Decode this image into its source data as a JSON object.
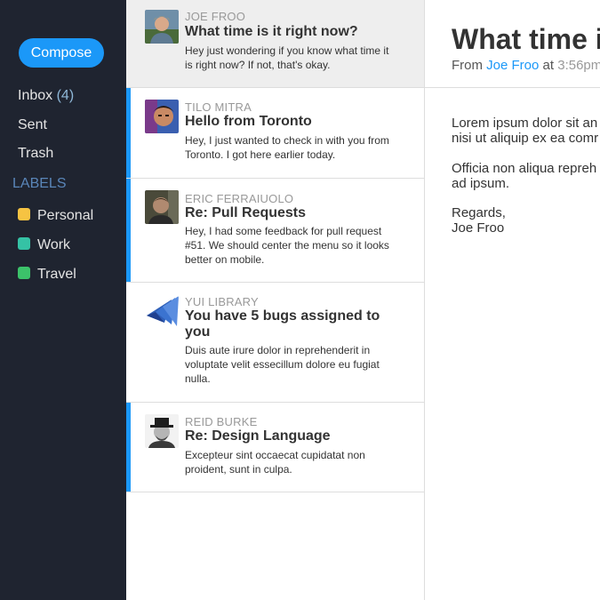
{
  "sidebar": {
    "compose_label": "Compose",
    "nav": [
      {
        "label": "Inbox",
        "count": "(4)"
      },
      {
        "label": "Sent"
      },
      {
        "label": "Trash"
      }
    ],
    "labels_heading": "LABELS",
    "labels": [
      {
        "label": "Personal",
        "color": "#f6c342"
      },
      {
        "label": "Work",
        "color": "#35c2a5"
      },
      {
        "label": "Travel",
        "color": "#3cc26a"
      }
    ]
  },
  "messages": [
    {
      "sender": "Joe Froo",
      "subject": "What time is it right now?",
      "preview": "Hey just wondering if you know what time it is right now? If not, that's okay.",
      "selected": true,
      "unread": false
    },
    {
      "sender": "Tilo Mitra",
      "subject": "Hello from Toronto",
      "preview": "Hey, I just wanted to check in with you from Toronto. I got here earlier today.",
      "selected": false,
      "unread": true
    },
    {
      "sender": "Eric Ferraiuolo",
      "subject": "Re: Pull Requests",
      "preview": "Hey, I had some feedback for pull request #51. We should center the menu so it looks better on mobile.",
      "selected": false,
      "unread": true
    },
    {
      "sender": "YUI Library",
      "subject": "You have 5 bugs assigned to you",
      "preview": "Duis aute irure dolor in reprehenderit in voluptate velit essecillum dolore eu fugiat nulla.",
      "selected": false,
      "unread": false
    },
    {
      "sender": "Reid Burke",
      "subject": "Re: Design Language",
      "preview": "Excepteur sint occaecat cupidatat non proident, sunt in culpa.",
      "selected": false,
      "unread": true
    }
  ],
  "content": {
    "title": "What time is",
    "meta_from": "From",
    "meta_sender": "Joe Froo",
    "meta_at": "at",
    "meta_time": "3:56pm",
    "paragraph1_line1": "Lorem ipsum dolor sit an",
    "paragraph1_line2": "nisi ut aliquip ex ea comr",
    "paragraph2_line1": "Officia non aliqua repreh",
    "paragraph2_line2": "ad ipsum.",
    "signoff_line1": "Regards,",
    "signoff_line2": "Joe Froo"
  }
}
